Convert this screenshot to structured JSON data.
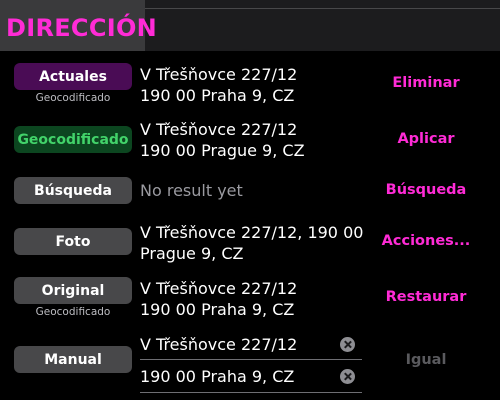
{
  "header": {
    "title": "DIRECCIÓN"
  },
  "colors": {
    "accent": "#ff2bd6",
    "success": "#42d36a",
    "button": "#48484a",
    "button_selected": "#4a0c55",
    "button_success": "#0c4620"
  },
  "rows": [
    {
      "button_label": "Actuales",
      "sublabel": "Geocodificado",
      "address_line1": "V Třešňovce 227/12",
      "address_line2": "190 00 Praha 9, CZ",
      "action_label": "Eliminar"
    },
    {
      "button_label": "Geocodificado",
      "address_line1": "V Třešňovce 227/12",
      "address_line2": "190 00 Prague 9, CZ",
      "action_label": "Aplicar"
    },
    {
      "button_label": "Búsqueda",
      "address_line1": "No result yet",
      "action_label": "Búsqueda"
    },
    {
      "button_label": "Foto",
      "address_line1": "V Třešňovce 227/12, 190 00",
      "address_line2": "Prague 9, CZ",
      "action_label": "Acciones..."
    },
    {
      "button_label": "Original",
      "sublabel": "Geocodificado",
      "address_line1": "V Třešňovce 227/12",
      "address_line2": "190 00 Praha 9, CZ",
      "action_label": "Restaurar"
    },
    {
      "button_label": "Manual",
      "field1_value": "V Třešňovce 227/12",
      "field2_value": "190 00 Praha 9, CZ",
      "action_label": "Igual"
    }
  ]
}
